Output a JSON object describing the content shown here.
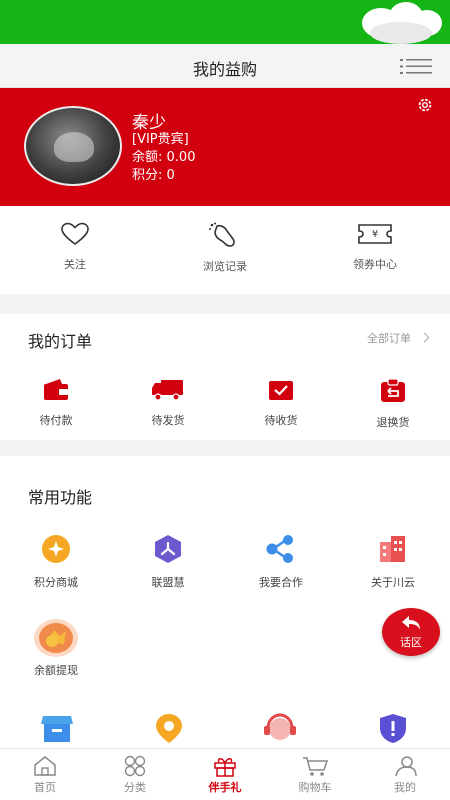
{
  "header": {
    "title": "我的益购"
  },
  "profile": {
    "name": "秦少",
    "level": "[VIP贵宾]",
    "balance_label": "余额:",
    "balance_value": "0.00",
    "points_label": "积分:",
    "points_value": "0"
  },
  "quick_links": [
    {
      "label": "关注",
      "icon": "heart-icon"
    },
    {
      "label": "浏览记录",
      "icon": "footprint-icon"
    },
    {
      "label": "领券中心",
      "icon": "coupon-icon"
    }
  ],
  "orders": {
    "title": "我的订单",
    "all_label": "全部订单",
    "items": [
      {
        "label": "待付款",
        "icon": "wallet-icon"
      },
      {
        "label": "待发货",
        "icon": "truck-icon"
      },
      {
        "label": "待收货",
        "icon": "receive-box-icon"
      },
      {
        "label": "退换货",
        "icon": "return-icon"
      }
    ]
  },
  "functions": {
    "title": "常用功能",
    "items": [
      {
        "label": "积分商城",
        "icon": "points-mall-icon"
      },
      {
        "label": "联盟慧",
        "icon": "alliance-icon"
      },
      {
        "label": "我要合作",
        "icon": "share-icon"
      },
      {
        "label": "关于川云",
        "icon": "building-icon"
      },
      {
        "label": "余额提现",
        "icon": "coin-icon"
      }
    ],
    "partial_icons": [
      "shop-icon",
      "location-pin-icon",
      "service-icon",
      "shield-icon"
    ]
  },
  "chat": {
    "label": "话区"
  },
  "tabs": [
    {
      "label": "首页",
      "icon": "home-icon"
    },
    {
      "label": "分类",
      "icon": "category-icon"
    },
    {
      "label": "伴手礼",
      "icon": "gift-icon",
      "active": true
    },
    {
      "label": "购物车",
      "icon": "cart-icon"
    },
    {
      "label": "我的",
      "icon": "user-icon"
    }
  ],
  "colors": {
    "brand_red": "#d2000f",
    "status_green": "#15b515",
    "gold": "#f5a623",
    "purple": "#6a5acd",
    "blue": "#3c8ee8"
  }
}
